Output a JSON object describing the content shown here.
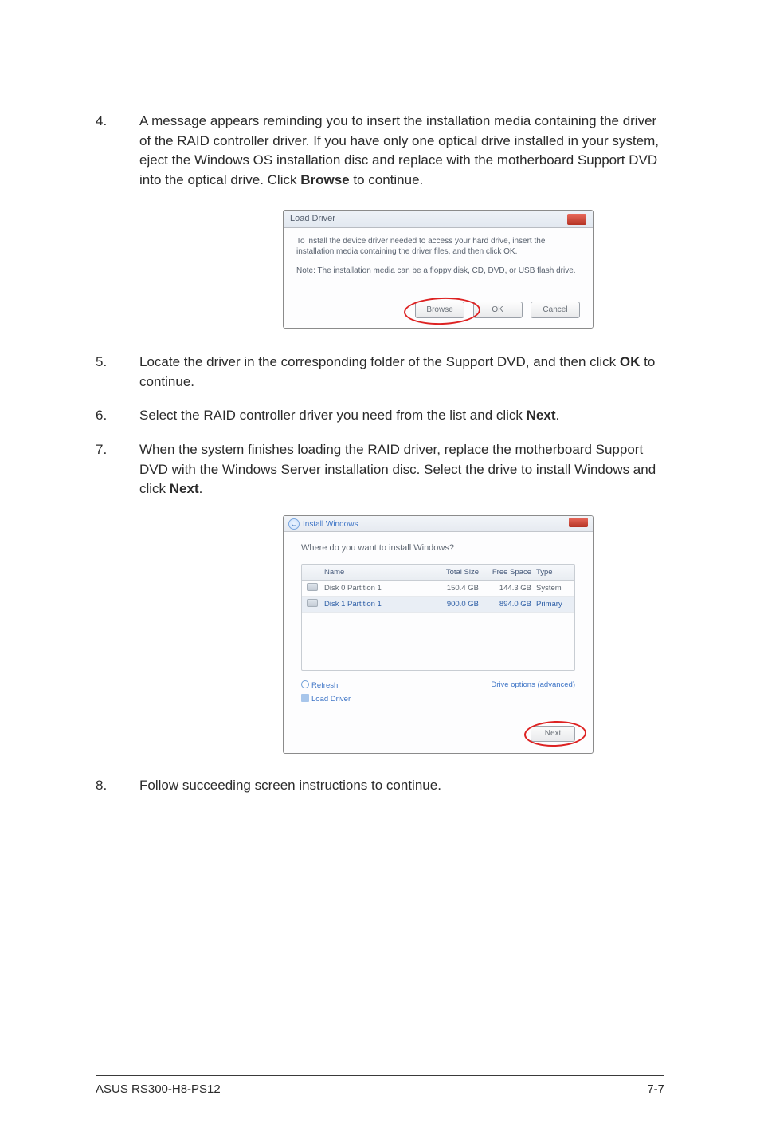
{
  "steps": {
    "s4": {
      "num": "4.",
      "text_a": "A message appears reminding you to insert the installation media containing the driver of the RAID controller driver. If you have only one optical drive installed in your system, eject the Windows OS installation disc and replace with the motherboard Support DVD into the optical drive. Click ",
      "bold": "Browse",
      "text_b": " to continue."
    },
    "s5": {
      "num": "5.",
      "text_a": "Locate the driver in the corresponding folder of the Support DVD, and then click ",
      "bold": "OK",
      "text_b": " to continue."
    },
    "s6": {
      "num": "6.",
      "text_a": "Select the RAID controller driver you need from the list and click ",
      "bold": "Next",
      "text_b": "."
    },
    "s7": {
      "num": "7.",
      "text_a": "When the system finishes loading the RAID driver, replace the motherboard Support DVD with the Windows Server installation disc. Select the drive to install Windows and click ",
      "bold": "Next",
      "text_b": "."
    },
    "s8": {
      "num": "8.",
      "text_a": "Follow succeeding screen instructions to continue."
    }
  },
  "dlg1": {
    "title": "Load Driver",
    "para1": "To install the device driver needed to access your hard drive, insert the installation media containing the driver files, and then click OK.",
    "para2": "Note: The installation media can be a floppy disk, CD, DVD, or USB flash drive.",
    "btn_browse": "Browse",
    "btn_ok": "OK",
    "btn_cancel": "Cancel"
  },
  "dlg2": {
    "title": "Install Windows",
    "question": "Where do you want to install Windows?",
    "head_name": "Name",
    "head_size": "Total Size",
    "head_free": "Free Space",
    "head_type": "Type",
    "rows": [
      {
        "name": "Disk 0 Partition 1",
        "size": "150.4 GB",
        "free": "144.3 GB",
        "type": "System"
      },
      {
        "name": "Disk 1 Partition 1",
        "size": "900.0 GB",
        "free": "894.0 GB",
        "type": "Primary"
      }
    ],
    "link_refresh": "Refresh",
    "link_load": "Load Driver",
    "link_adv": "Drive options (advanced)",
    "btn_next": "Next"
  },
  "footer": {
    "left": "ASUS RS300-H8-PS12",
    "right": "7-7"
  }
}
